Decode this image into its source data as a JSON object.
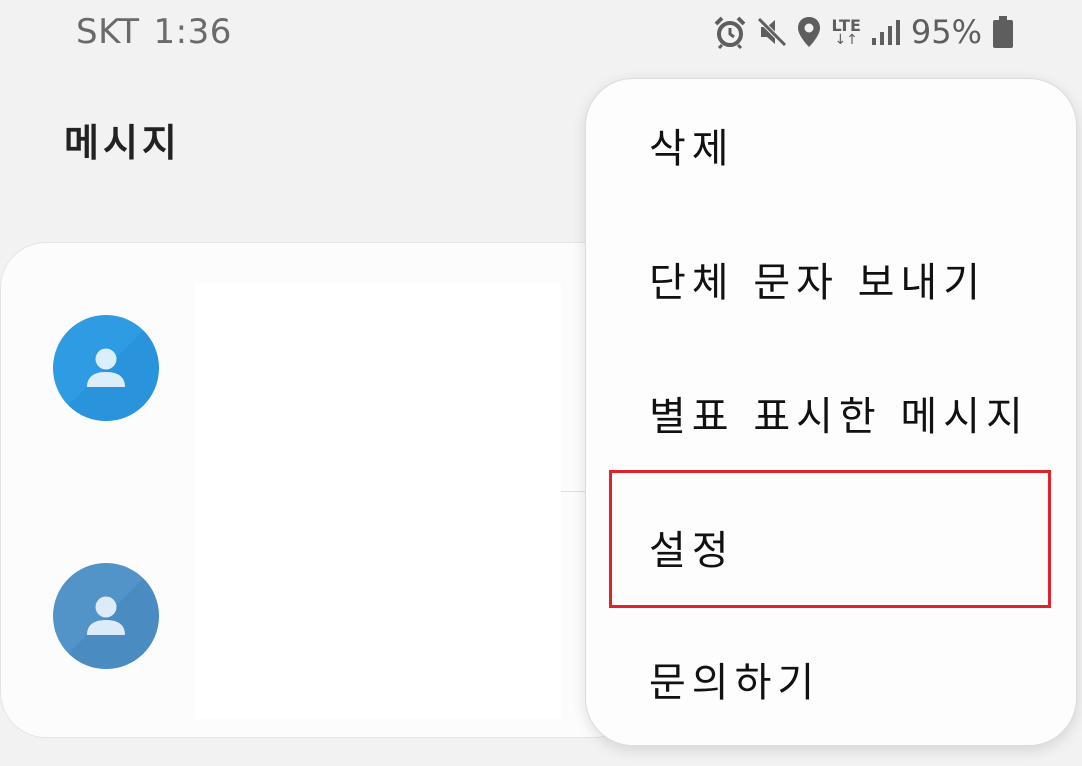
{
  "status_bar": {
    "carrier": "SKT",
    "time": "1:36",
    "network_label": "LTE",
    "network_arrows": "↓↑",
    "battery_percent": "95%",
    "icons": [
      "alarm-icon",
      "mute-icon",
      "location-icon",
      "lte-icon",
      "signal-icon",
      "battery-icon"
    ]
  },
  "header": {
    "title": "메시지"
  },
  "conversations": [
    {
      "avatar_icon": "person-icon",
      "avatar_color": "#2e9be2"
    },
    {
      "avatar_icon": "person-icon",
      "avatar_color": "#5294c8"
    }
  ],
  "menu": {
    "items": [
      {
        "label": "삭제"
      },
      {
        "label": "단체 문자 보내기"
      },
      {
        "label": "별표 표시한 메시지"
      },
      {
        "label": "설정",
        "highlighted": true
      },
      {
        "label": "문의하기"
      }
    ]
  },
  "colors": {
    "background": "#f2f2f2",
    "highlight": "#e0222b",
    "avatar_blue": "#2e9be2",
    "avatar_steel": "#5294c8"
  }
}
